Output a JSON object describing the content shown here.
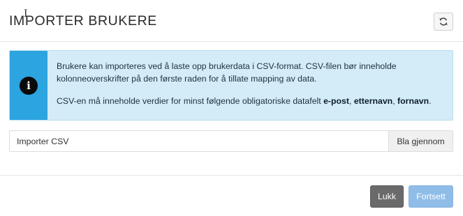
{
  "header": {
    "title": "IMPORTER BRUKERE",
    "refresh_icon": "refresh-icon"
  },
  "info": {
    "icon": "info-icon",
    "icon_glyph": "i",
    "paragraph1": "Brukere kan importeres ved å laste opp brukerdata i CSV-format. CSV-filen bør inneholde kolonneoverskrifter på den første raden for å tillate mapping av data.",
    "paragraph2_prefix": "CSV-en må inneholde verdier for minst følgende obligatoriske datafelt ",
    "required_fields": [
      "e-post",
      "etternavn",
      "fornavn"
    ],
    "separator": ", ",
    "paragraph2_suffix": "."
  },
  "file_input": {
    "label": "Importer CSV",
    "browse_label": "Bla gjennom"
  },
  "footer": {
    "close_label": "Lukk",
    "continue_label": "Fortsett"
  },
  "colors": {
    "info_bg": "#d4ecf8",
    "info_accent": "#2ba4e0",
    "close_btn": "#6a6a6a",
    "continue_btn": "#8fbde8"
  }
}
